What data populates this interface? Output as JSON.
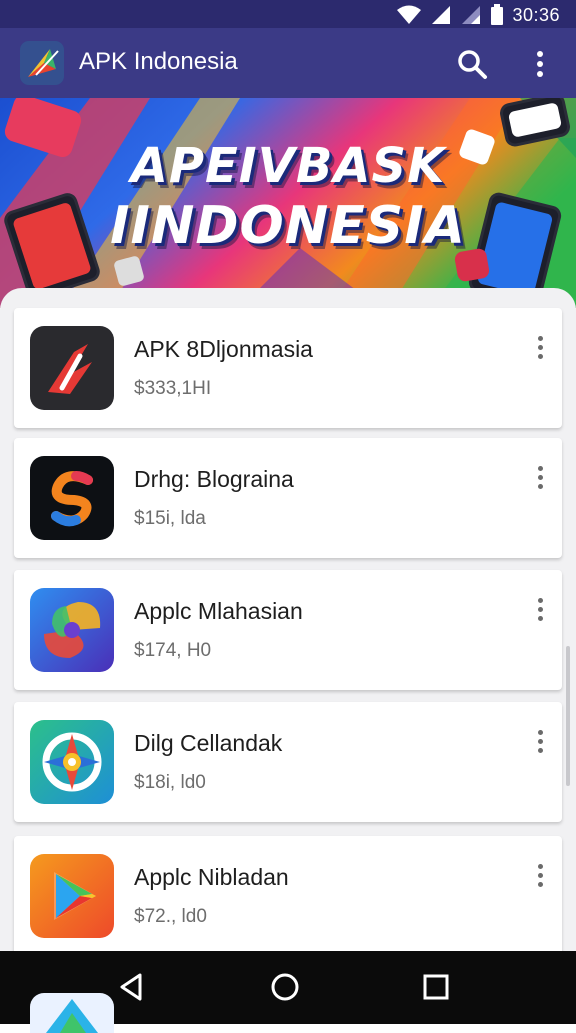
{
  "status_bar": {
    "time": "30:36",
    "icons": [
      "wifi-icon",
      "signal-icon",
      "signal-icon",
      "battery-icon"
    ]
  },
  "app_bar": {
    "title": "APK Indonesia",
    "logo_icon": "apk-logo-icon",
    "actions": [
      "search-icon",
      "more-vert-icon"
    ],
    "background": "#3b3a86"
  },
  "banner": {
    "line1": "APEIVBASK",
    "line2": "IINDONESIA"
  },
  "apps": [
    {
      "name": "APK 8Dljonmasia",
      "price": "$333,1HI",
      "icon": "red-app-icon"
    },
    {
      "name": "Drhg: Blograina",
      "price": "$15i, lda",
      "icon": "s-logo-app-icon"
    },
    {
      "name": "Applc Mlahasian",
      "price": "$174, H0",
      "icon": "swirl-app-icon"
    },
    {
      "name": "Dilg Cellandak",
      "price": "$18i, ld0",
      "icon": "compass-app-icon"
    },
    {
      "name": "Applc Nibladan",
      "price": "$72., ld0",
      "icon": "play-app-icon"
    }
  ],
  "nav_bar": {
    "buttons": [
      "back-icon",
      "home-icon",
      "recents-icon"
    ]
  },
  "colors": {
    "status_bar": "#2c2a6e",
    "app_bar": "#3b3a86",
    "sheet": "#f1f1f3",
    "nav_bar": "#0b0b0b"
  }
}
